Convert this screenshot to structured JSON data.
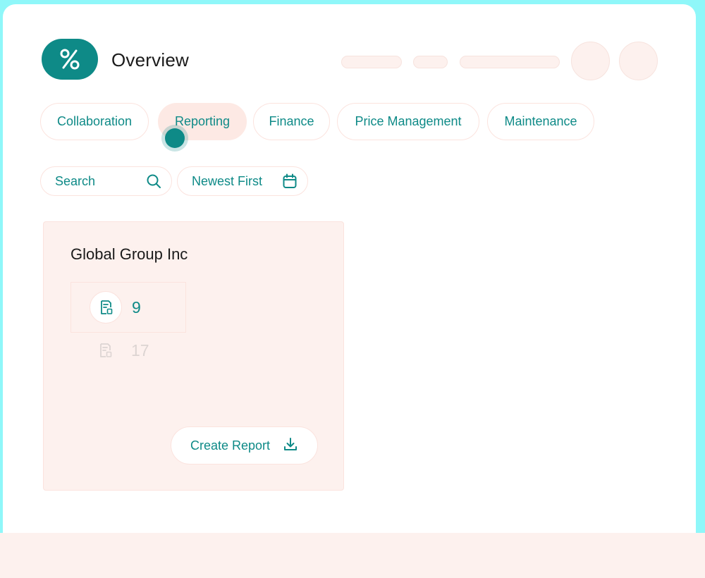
{
  "header": {
    "logo_icon": "percent-icon",
    "title": "Overview",
    "accent_color": "#0e8a87"
  },
  "tabs": [
    {
      "label": "Collaboration",
      "active": false
    },
    {
      "label": "Reporting",
      "active": true
    },
    {
      "label": "Finance",
      "active": false
    },
    {
      "label": "Price Management",
      "active": false
    },
    {
      "label": "Maintenance",
      "active": false
    }
  ],
  "filters": {
    "search_placeholder": "Search",
    "search_icon": "search-icon",
    "sort_label": "Newest First",
    "sort_icon": "calendar-icon"
  },
  "card": {
    "title": "Global Group Inc",
    "stats": [
      {
        "icon": "report-document-icon",
        "value": "9"
      },
      {
        "icon": "report-document-icon",
        "value": "17"
      }
    ],
    "create_label": "Create Report",
    "create_icon": "download-icon"
  }
}
